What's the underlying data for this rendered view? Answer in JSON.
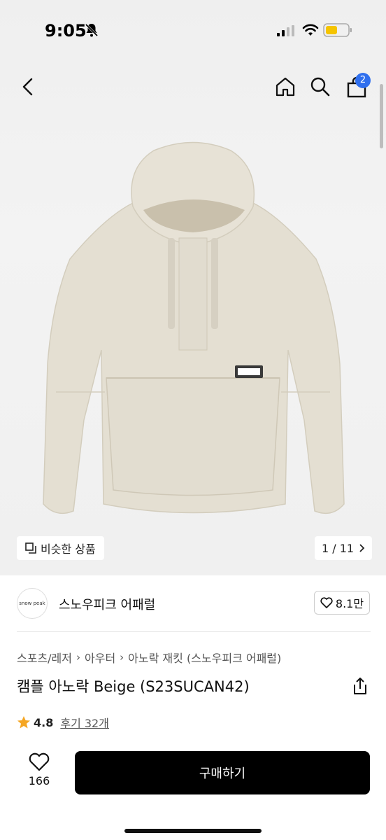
{
  "status_bar": {
    "time": "9:05",
    "battery_color": "#f5c400"
  },
  "header": {
    "back_icon": "chevron-left-icon",
    "home_icon": "home-icon",
    "search_icon": "search-icon",
    "bag_icon": "shopping-bag-icon",
    "cart_count": "2",
    "badge_color": "#2f6fee"
  },
  "gallery": {
    "similar_label": "비슷한 상품",
    "page_counter": "1 / 11"
  },
  "brand": {
    "name": "스노우피크 어패럴",
    "logo_text": "snow peak",
    "likes": "8.1만"
  },
  "breadcrumb": [
    "스포츠/레저",
    "아우터",
    "아노락 재킷 (스노우피크 어패럴)"
  ],
  "product": {
    "title": "캠플 아노락 Beige (S23SUCAN42)",
    "rating": "4.8",
    "reviews": "후기 32개",
    "star_color": "#f5a623"
  },
  "bottom_bar": {
    "wish_count": "166",
    "buy_label": "구매하기"
  }
}
